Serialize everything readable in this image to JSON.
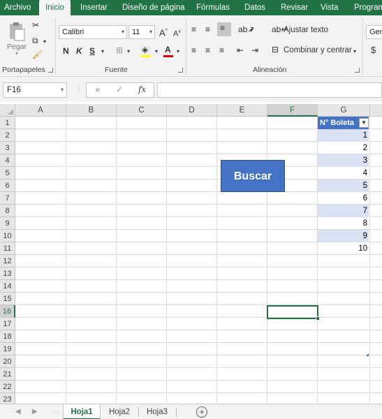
{
  "menu": {
    "tabs": [
      "Archivo",
      "Inicio",
      "Insertar",
      "Diseño de página",
      "Fórmulas",
      "Datos",
      "Revisar",
      "Vista",
      "Program"
    ],
    "active": "Inicio"
  },
  "ribbon": {
    "groups": {
      "clipboard": "Portapapeles",
      "font": "Fuente",
      "alignment": "Alineación"
    },
    "paste_label": "Pegar",
    "font_name": "Calibri",
    "font_size": "11",
    "grow_font": "A",
    "shrink_font": "A",
    "bold": "N",
    "italic": "K",
    "underline": "S",
    "font_color_letter": "A",
    "wrap_text": "Ajustar texto",
    "merge_center": "Combinar y centrar",
    "number_format_partial": "Gen",
    "currency_symbol": "$"
  },
  "formula_bar": {
    "name_box": "F16",
    "fx_label": "fx",
    "cancel_icon": "×",
    "enter_icon": "✓",
    "value": ""
  },
  "grid": {
    "columns": [
      "A",
      "B",
      "C",
      "D",
      "E",
      "F",
      "G"
    ],
    "rows": [
      "1",
      "2",
      "3",
      "4",
      "5",
      "6",
      "7",
      "8",
      "9",
      "10",
      "11",
      "12",
      "13",
      "14",
      "15",
      "16",
      "17",
      "18",
      "19",
      "20",
      "21",
      "22",
      "23"
    ],
    "selected_column": "F",
    "selected_row": "16"
  },
  "table": {
    "header": "N° Boleta",
    "values": [
      "1",
      "2",
      "3",
      "4",
      "5",
      "6",
      "7",
      "8",
      "9",
      "10"
    ]
  },
  "button": {
    "label": "Buscar"
  },
  "sheets": {
    "tabs": [
      "Hoja1",
      "Hoja2",
      "Hoja3"
    ],
    "active": "Hoja1",
    "add_symbol": "+"
  },
  "colors": {
    "excel_green": "#217346",
    "table_header": "#4472c4",
    "table_band": "#d9e1f2",
    "button": "#4472c4"
  }
}
